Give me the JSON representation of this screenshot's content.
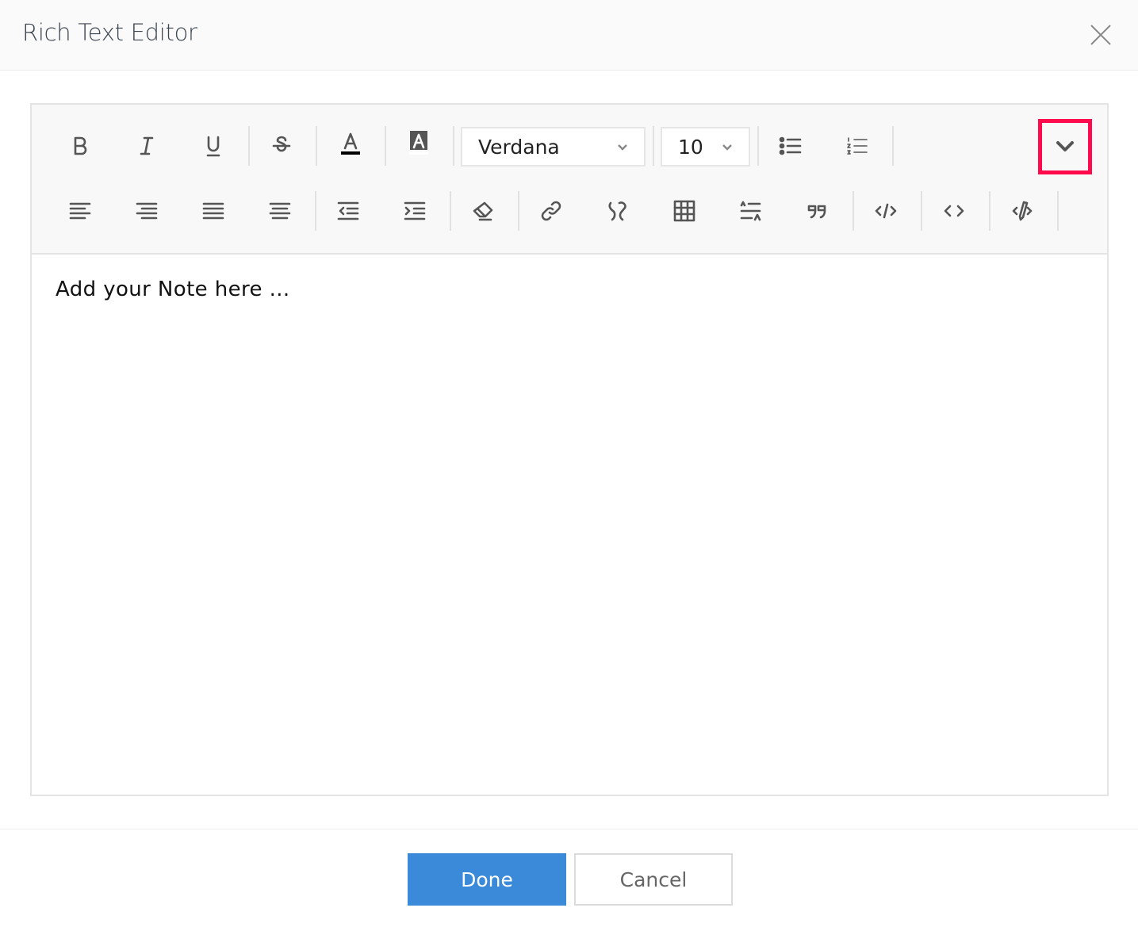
{
  "dialog": {
    "title": "Rich Text Editor"
  },
  "toolbar": {
    "font_family": "Verdana",
    "font_size": "10",
    "text_color": "#000000",
    "highlight_color": "#ffffff",
    "more_highlight_color": "#ff0a4c"
  },
  "editor": {
    "placeholder": "Add your Note here ..."
  },
  "footer": {
    "done_label": "Done",
    "cancel_label": "Cancel"
  }
}
